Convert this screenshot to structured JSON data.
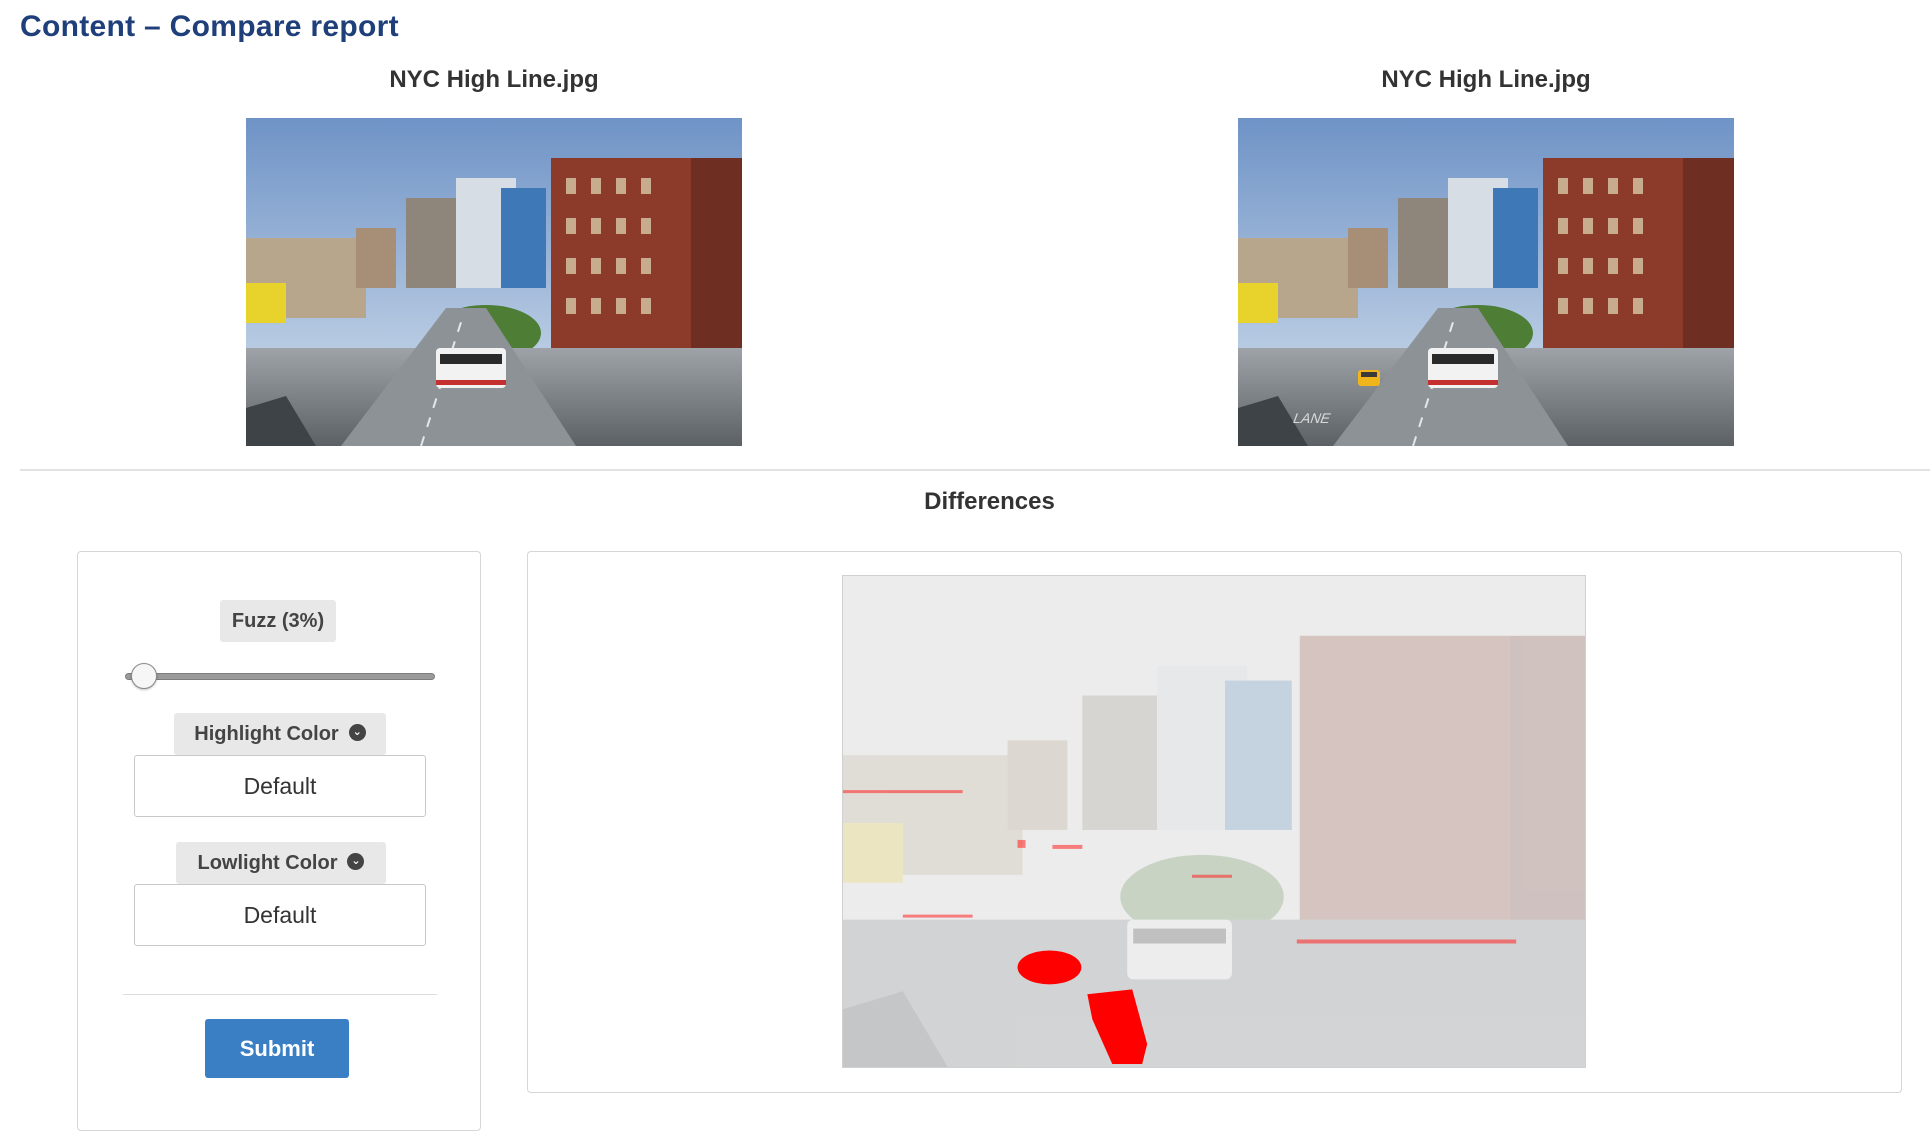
{
  "page": {
    "title": "Content – Compare report"
  },
  "images": {
    "left_title": "NYC High Line.jpg",
    "right_title": "NYC High Line.jpg"
  },
  "differences": {
    "title": "Differences"
  },
  "controls": {
    "fuzz_label": "Fuzz (3%)",
    "fuzz_percent": 3,
    "highlight_label": "Highlight Color",
    "highlight_value": "Default",
    "lowlight_label": "Lowlight Color",
    "lowlight_value": "Default",
    "submit_label": "Submit",
    "chevron_icon": "chevron-down-circle-icon"
  },
  "colors": {
    "title": "#1f3f7a",
    "submit": "#3a7fc3",
    "diff_highlight": "#ff0000"
  }
}
